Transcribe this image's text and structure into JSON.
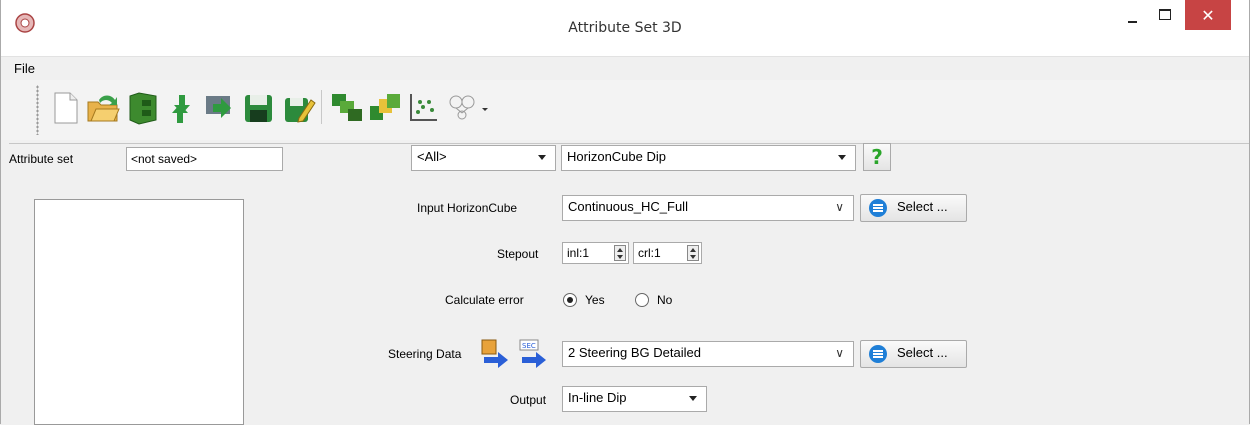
{
  "window": {
    "title": "Attribute Set 3D",
    "close_glyph": "✕"
  },
  "menu": {
    "file": "File"
  },
  "toolbar": {
    "icons": [
      "new-document-icon",
      "open-folder-icon",
      "save-cabinet-icon",
      "refresh-icon",
      "import-icon",
      "save-disk-icon",
      "edit-save-icon",
      "add-attributes-icon",
      "display-attributes-icon",
      "crossplot-icon",
      "fingerprint-icon"
    ]
  },
  "attribute_set": {
    "label": "Attribute set",
    "value": "<not saved>"
  },
  "filter": {
    "value": "<All>"
  },
  "attribute_type": {
    "value": "HorizonCube Dip"
  },
  "help": {
    "glyph": "?"
  },
  "input_horizoncube": {
    "label": "Input HorizonCube",
    "value": "Continuous_HC_Full",
    "select_label": "Select ..."
  },
  "stepout": {
    "label": "Stepout",
    "inl": "inl:1",
    "crl": "crl:1"
  },
  "calculate_error": {
    "label": "Calculate error",
    "yes": "Yes",
    "no": "No",
    "selected": "Yes"
  },
  "steering": {
    "label": "Steering Data",
    "value": "2 Steering BG Detailed",
    "select_label": "Select ...",
    "sec_text": "SEC"
  },
  "output": {
    "label": "Output",
    "value": "In-line Dip"
  },
  "colors": {
    "close": "#c74444",
    "accent": "#1f7fd7",
    "help": "#2aa52a"
  }
}
